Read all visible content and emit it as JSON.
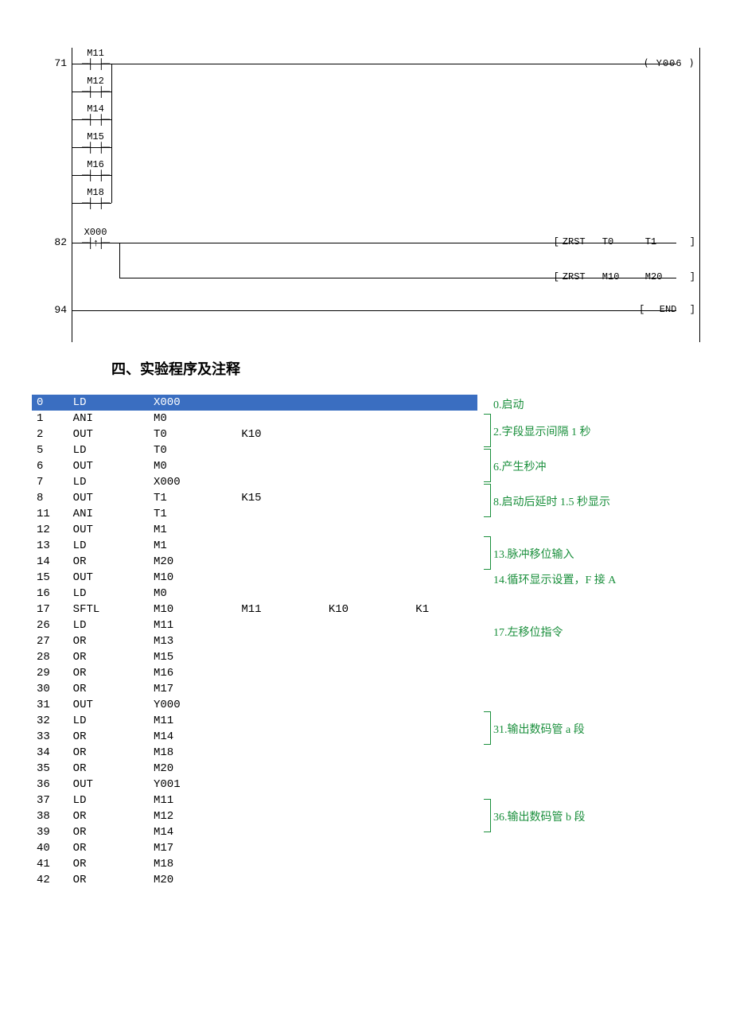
{
  "ladder": {
    "rungs": [
      {
        "num": "71",
        "contacts": [
          "M11",
          "M12",
          "M14",
          "M15",
          "M16",
          "M18"
        ],
        "output_type": "coil",
        "coil": "Y006"
      },
      {
        "num": "82",
        "contacts_pulse": "X000",
        "outputs": [
          {
            "type": "box",
            "op": "ZRST",
            "a1": "T0",
            "a2": "T1"
          },
          {
            "type": "box",
            "op": "ZRST",
            "a1": "M10",
            "a2": "M20"
          }
        ]
      },
      {
        "num": "94",
        "outputs": [
          {
            "type": "end",
            "label": "END"
          }
        ]
      }
    ]
  },
  "heading": "四、实验程序及注释",
  "instructions": [
    {
      "step": "0",
      "op": "LD",
      "a1": "X000",
      "a2": "",
      "a3": "",
      "a4": "",
      "hl": true
    },
    {
      "step": "1",
      "op": "ANI",
      "a1": "M0",
      "a2": "",
      "a3": "",
      "a4": ""
    },
    {
      "step": "2",
      "op": "OUT",
      "a1": "T0",
      "a2": "K10",
      "a3": "",
      "a4": ""
    },
    {
      "step": "5",
      "op": "LD",
      "a1": "T0",
      "a2": "",
      "a3": "",
      "a4": ""
    },
    {
      "step": "6",
      "op": "OUT",
      "a1": "M0",
      "a2": "",
      "a3": "",
      "a4": ""
    },
    {
      "step": "7",
      "op": "LD",
      "a1": "X000",
      "a2": "",
      "a3": "",
      "a4": ""
    },
    {
      "step": "8",
      "op": "OUT",
      "a1": "T1",
      "a2": "K15",
      "a3": "",
      "a4": ""
    },
    {
      "step": "11",
      "op": "ANI",
      "a1": "T1",
      "a2": "",
      "a3": "",
      "a4": ""
    },
    {
      "step": "12",
      "op": "OUT",
      "a1": "M1",
      "a2": "",
      "a3": "",
      "a4": ""
    },
    {
      "step": "13",
      "op": "LD",
      "a1": "M1",
      "a2": "",
      "a3": "",
      "a4": ""
    },
    {
      "step": "14",
      "op": "OR",
      "a1": "M20",
      "a2": "",
      "a3": "",
      "a4": ""
    },
    {
      "step": "15",
      "op": "OUT",
      "a1": "M10",
      "a2": "",
      "a3": "",
      "a4": ""
    },
    {
      "step": "16",
      "op": "LD",
      "a1": "M0",
      "a2": "",
      "a3": "",
      "a4": ""
    },
    {
      "step": "17",
      "op": "SFTL",
      "a1": "M10",
      "a2": "M11",
      "a3": "K10",
      "a4": "K1"
    },
    {
      "step": "26",
      "op": "LD",
      "a1": "M11",
      "a2": "",
      "a3": "",
      "a4": ""
    },
    {
      "step": "27",
      "op": "OR",
      "a1": "M13",
      "a2": "",
      "a3": "",
      "a4": ""
    },
    {
      "step": "28",
      "op": "OR",
      "a1": "M15",
      "a2": "",
      "a3": "",
      "a4": ""
    },
    {
      "step": "29",
      "op": "OR",
      "a1": "M16",
      "a2": "",
      "a3": "",
      "a4": ""
    },
    {
      "step": "30",
      "op": "OR",
      "a1": "M17",
      "a2": "",
      "a3": "",
      "a4": ""
    },
    {
      "step": "31",
      "op": "OUT",
      "a1": "Y000",
      "a2": "",
      "a3": "",
      "a4": ""
    },
    {
      "step": "32",
      "op": "LD",
      "a1": "M11",
      "a2": "",
      "a3": "",
      "a4": ""
    },
    {
      "step": "33",
      "op": "OR",
      "a1": "M14",
      "a2": "",
      "a3": "",
      "a4": ""
    },
    {
      "step": "34",
      "op": "OR",
      "a1": "M18",
      "a2": "",
      "a3": "",
      "a4": ""
    },
    {
      "step": "35",
      "op": "OR",
      "a1": "M20",
      "a2": "",
      "a3": "",
      "a4": ""
    },
    {
      "step": "36",
      "op": "OUT",
      "a1": "Y001",
      "a2": "",
      "a3": "",
      "a4": ""
    },
    {
      "step": "37",
      "op": "LD",
      "a1": "M11",
      "a2": "",
      "a3": "",
      "a4": ""
    },
    {
      "step": "38",
      "op": "OR",
      "a1": "M12",
      "a2": "",
      "a3": "",
      "a4": ""
    },
    {
      "step": "39",
      "op": "OR",
      "a1": "M14",
      "a2": "",
      "a3": "",
      "a4": ""
    },
    {
      "step": "40",
      "op": "OR",
      "a1": "M17",
      "a2": "",
      "a3": "",
      "a4": ""
    },
    {
      "step": "41",
      "op": "OR",
      "a1": "M18",
      "a2": "",
      "a3": "",
      "a4": ""
    },
    {
      "step": "42",
      "op": "OR",
      "a1": "M20",
      "a2": "",
      "a3": "",
      "a4": ""
    }
  ],
  "notes": {
    "n0": "0.启动",
    "n2": "2.字段显示间隔 1 秒",
    "n6": "6.产生秒冲",
    "n8": "8.启动后延时 1.5 秒显示",
    "n13": "13.脉冲移位输入",
    "n14": "14.循环显示设置，F 接 A",
    "n17": "17.左移位指令",
    "n31": "31.输出数码管 a 段",
    "n36": "36.输出数码管 b 段"
  }
}
